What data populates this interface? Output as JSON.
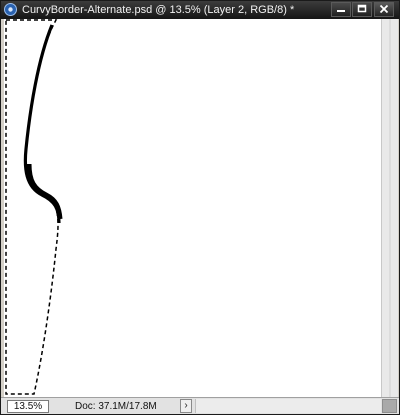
{
  "window": {
    "title": "CurvyBorder-Alternate.psd @ 13.5% (Layer 2, RGB/8) *",
    "app_icon": "photoshop-icon",
    "controls": {
      "minimize": "minimize-icon",
      "maximize": "maximize-icon",
      "close": "close-icon"
    }
  },
  "status": {
    "zoom": "13.5%",
    "doc_info": "Doc: 37.1M/17.8M",
    "menu_arrow": "›"
  },
  "colors": {
    "titlebar": "#1e1e1e",
    "statusbar": "#e2e2e2",
    "canvas": "#ffffff",
    "curve": "#000000"
  }
}
